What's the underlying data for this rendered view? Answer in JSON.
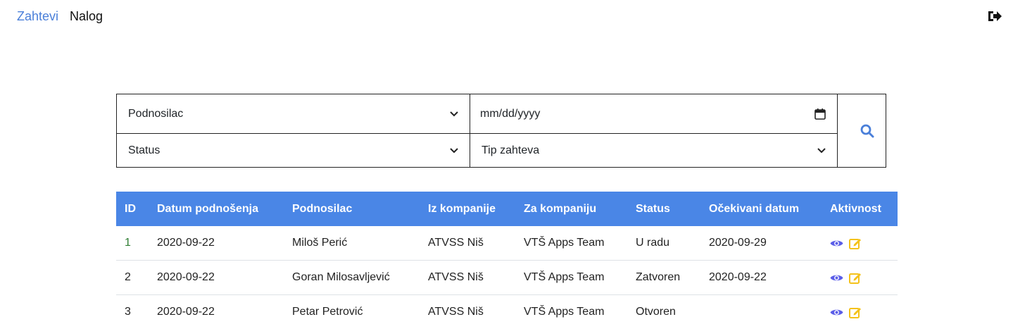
{
  "nav": {
    "items": [
      {
        "label": "Zahtevi",
        "active": true
      },
      {
        "label": "Nalog",
        "active": false
      }
    ],
    "logout_icon": "sign-out-icon"
  },
  "filters": {
    "submitter_select": "Podnosilac",
    "date_input": "mm/dd/yyyy",
    "status_select": "Status",
    "request_type_select": "Tip zahteva",
    "search_icon": "search-icon"
  },
  "table": {
    "headers": [
      "ID",
      "Datum podnošenja",
      "Podnosilac",
      "Iz kompanije",
      "Za kompaniju",
      "Status",
      "Očekivani datum",
      "Aktivnost"
    ],
    "rows": [
      {
        "id": "1",
        "date": "2020-09-22",
        "submitter": "Miloš Perić",
        "from_company": "ATVSS Niš",
        "to_company": "VTŠ Apps Team",
        "status": "U radu",
        "expected": "2020-09-29"
      },
      {
        "id": "2",
        "date": "2020-09-22",
        "submitter": "Goran Milosavljević",
        "from_company": "ATVSS Niš",
        "to_company": "VTŠ Apps Team",
        "status": "Zatvoren",
        "expected": "2020-09-22"
      },
      {
        "id": "3",
        "date": "2020-09-22",
        "submitter": "Petar Petrović",
        "from_company": "ATVSS Niš",
        "to_company": "VTŠ Apps Team",
        "status": "Otvoren",
        "expected": ""
      }
    ],
    "action_icons": [
      "eye-icon",
      "edit-icon"
    ]
  },
  "colors": {
    "accent": "#4a7fd9",
    "header_bg": "#4a86e6",
    "view_icon": "#5b5ee8",
    "edit_icon": "#f4c21b",
    "id_link": "#2e7d32"
  }
}
